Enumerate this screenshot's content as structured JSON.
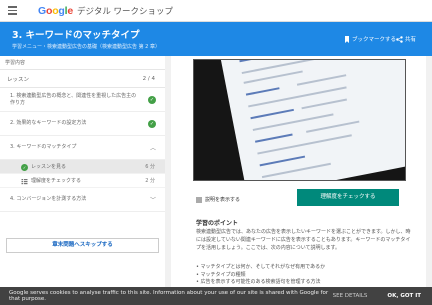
{
  "app": {
    "logo_letters": [
      "G",
      "o",
      "o",
      "g",
      "l",
      "e"
    ],
    "brand_subtitle": "デジタル ワークショップ"
  },
  "header": {
    "lesson_title": "3. キーワードのマッチタイプ",
    "breadcrumb": "学習メニュー・検索連動型広告の基礎（検索連動型広告 第 2 章）",
    "bookmark_label": "ブックマークする",
    "share_label": "共有"
  },
  "sidebar": {
    "section_label": "学習内容",
    "lessons_label": "レッスン",
    "lessons_count": "2 / 4",
    "lessons": [
      {
        "title": "1. 検索連動型広告の概念と、関連性を重視した広告主の作り方",
        "status": "completed",
        "icon": "check-icon"
      },
      {
        "title": "2. 効果的なキーワードの設定方法",
        "status": "completed",
        "icon": "check-icon"
      },
      {
        "title": "3. キーワードのマッチタイプ",
        "status": "expanded",
        "icon": "chevron-up-icon"
      }
    ],
    "sub_items": [
      {
        "label": "レッスンを見る",
        "duration": "6 分",
        "icon": "check-icon",
        "active": true
      },
      {
        "label": "理解度をチェックする",
        "duration": "2 分",
        "icon": "quiz-icon",
        "active": false
      }
    ],
    "next_lesson": {
      "title": "4. コンバージョンを計測する方法",
      "icon": "chevron-down-icon"
    },
    "skip_button": "章末問題へスキップする"
  },
  "content": {
    "description_link": "説明を表示する",
    "check_button": "理解度をチェックする",
    "points_title": "学習のポイント",
    "body": "検索連動型広告では、あなたの広告を表示したいキーワードを選ぶことができます。しかし、時には設定していない関連キーワードに広告を表示することもあります。キーワードのマッチタイプを活用しましょう。ここでは、次の内容について説明します。",
    "bullets": [
      "• マッチタイプとは何か、そしてそれがなぜ有用であるか",
      "• マッチタイプの種類",
      "• 広告を表示する可能性のある検索語句を管理する方法"
    ]
  },
  "cookie_bar": {
    "message": "Google serves cookies to analyse traffic to this site. Information about your use of our site is shared with Google for that purpose.",
    "details": "SEE DETAILS",
    "ok": "OK, GOT IT"
  }
}
